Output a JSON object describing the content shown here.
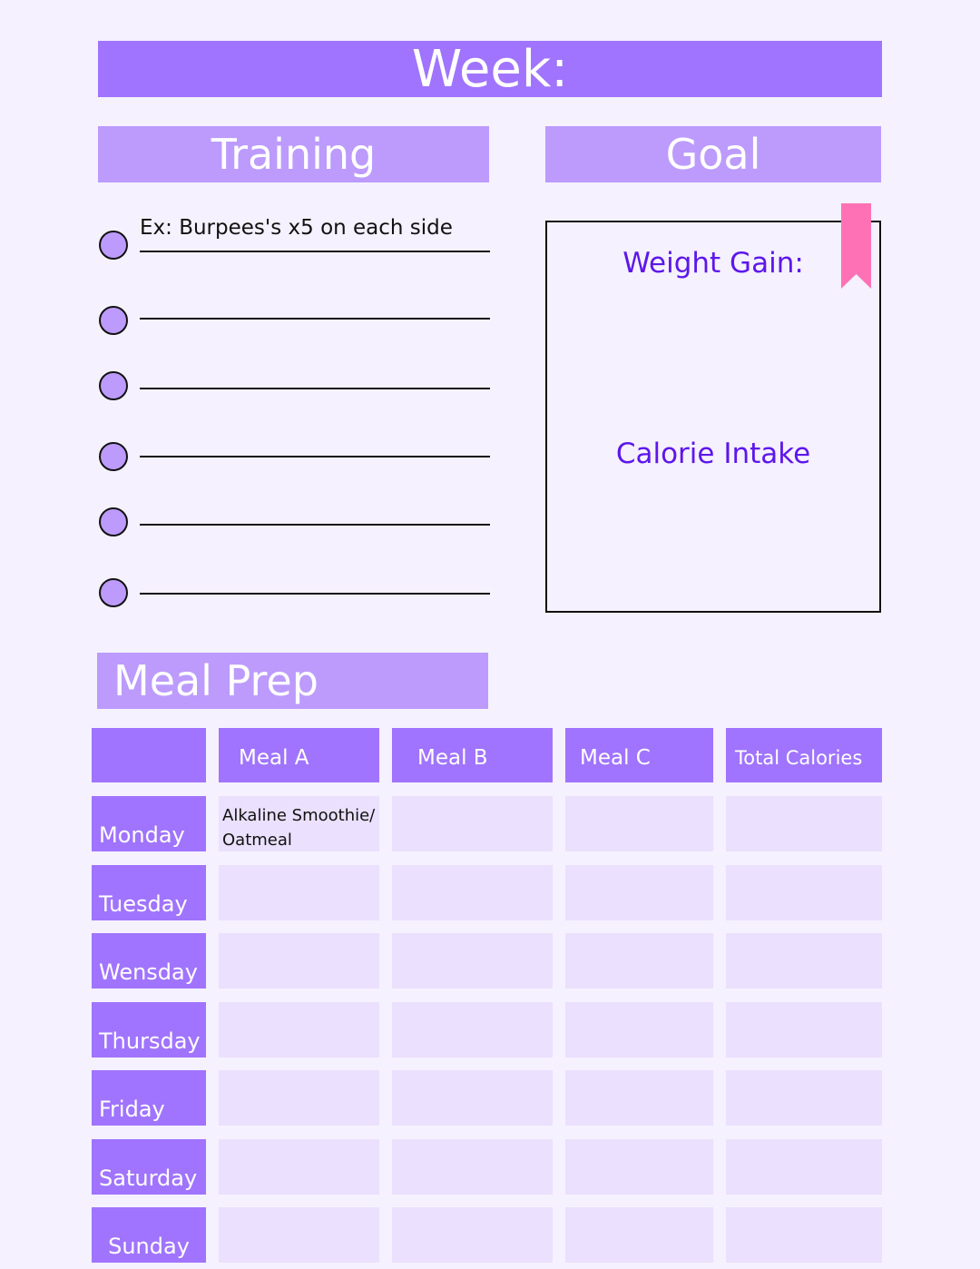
{
  "header": {
    "week_label": "Week:"
  },
  "training": {
    "title": "Training",
    "items": [
      {
        "text": "Ex: Burpees's x5 on each side"
      },
      {
        "text": ""
      },
      {
        "text": ""
      },
      {
        "text": ""
      },
      {
        "text": ""
      },
      {
        "text": ""
      }
    ]
  },
  "goal": {
    "title": "Goal",
    "weight_gain_label": "Weight Gain:",
    "calorie_intake_label": "Calorie Intake",
    "ribbon_color": "#fe72b5"
  },
  "meal_prep": {
    "title": "Meal Prep",
    "columns": [
      "",
      "Meal A",
      "Meal B",
      "Meal C",
      "Total Calories"
    ],
    "rows": [
      {
        "day": "Monday",
        "cells": [
          "Alkaline Smoothie/ Oatmeal",
          "",
          "",
          ""
        ]
      },
      {
        "day": "Tuesday",
        "cells": [
          "",
          "",
          "",
          ""
        ]
      },
      {
        "day": "Wensday",
        "cells": [
          "",
          "",
          "",
          ""
        ]
      },
      {
        "day": "Thursday",
        "cells": [
          "",
          "",
          "",
          ""
        ]
      },
      {
        "day": "Friday",
        "cells": [
          "",
          "",
          "",
          ""
        ]
      },
      {
        "day": "Saturday",
        "cells": [
          "",
          "",
          "",
          ""
        ]
      },
      {
        "day": "Sunday",
        "cells": [
          "",
          "",
          "",
          ""
        ]
      }
    ]
  },
  "colors": {
    "accent_dark": "#a074fe",
    "accent_light": "#bc9bfd",
    "cell_bg": "#ebe0fd",
    "goal_text": "#5d17ea",
    "page_bg": "#f5f1fe"
  }
}
